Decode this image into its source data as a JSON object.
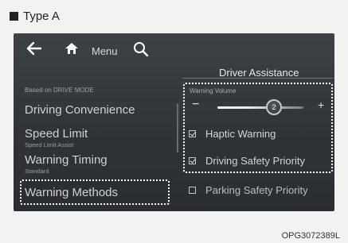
{
  "caption": {
    "label": "Type A"
  },
  "topbar": {
    "menu_label": "Menu"
  },
  "panel": {
    "title": "Driver Assistance"
  },
  "left_menu": {
    "section_label": "Based on DRIVE MODE",
    "items": [
      {
        "label": "Driving Convenience",
        "sub": ""
      },
      {
        "label": "Speed Limit",
        "sub": "Speed Limit Assist"
      },
      {
        "label": "Warning Timing",
        "sub": "Standard"
      },
      {
        "label": "Warning Methods",
        "sub": ""
      }
    ]
  },
  "settings": {
    "volume_label": "Warning Volume",
    "volume_value": "2",
    "minus": "−",
    "plus": "+",
    "options": [
      {
        "label": "Haptic Warning",
        "checked": true
      },
      {
        "label": "Driving Safety Priority",
        "checked": true
      },
      {
        "label": "Parking Safety Priority",
        "checked": false
      }
    ]
  },
  "figure_code": "OPG3072389L"
}
